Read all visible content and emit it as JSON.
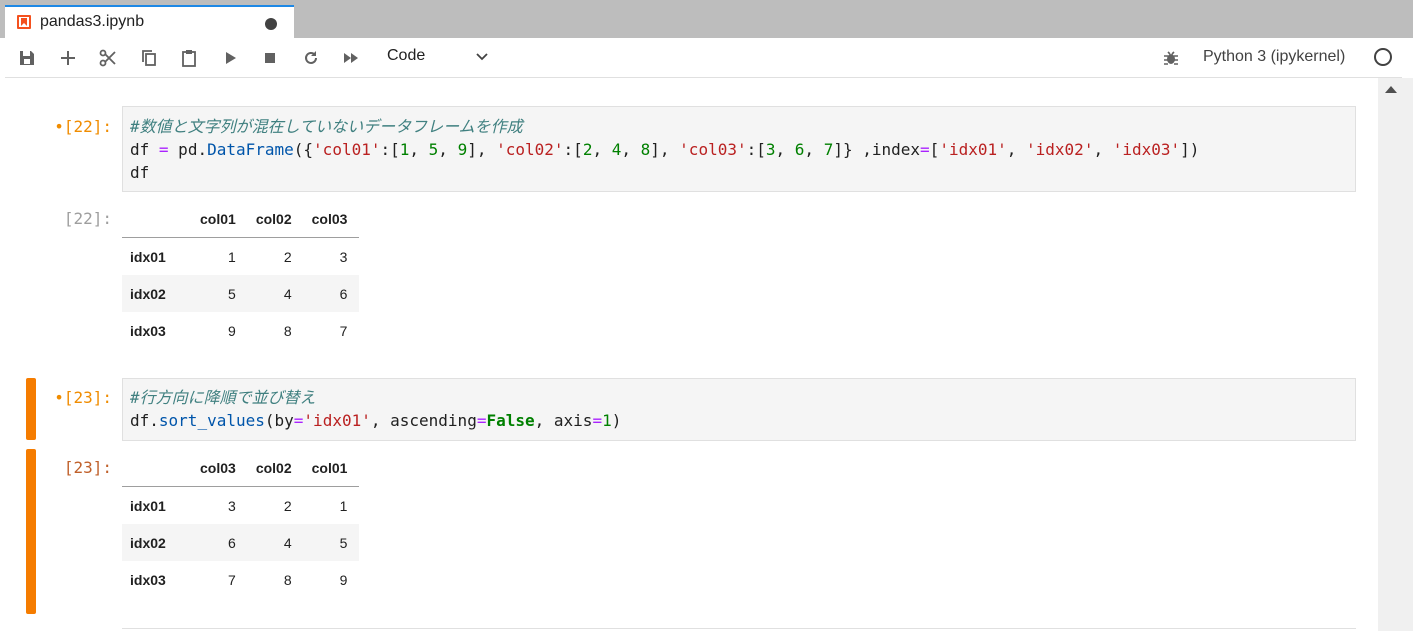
{
  "tab": {
    "title": "pandas3.ipynb",
    "icon": "notebook-icon"
  },
  "toolbar": {
    "buttons": [
      "save-icon",
      "add-icon",
      "cut-icon",
      "copy-icon",
      "paste-icon",
      "run-icon",
      "stop-icon",
      "restart-icon",
      "fast-forward-icon"
    ],
    "cell_type": "Code",
    "kernel": "Python 3 (ipykernel)"
  },
  "cells": [
    {
      "in_prompt": "•[22]:",
      "out_prompt": "[22]:",
      "code": {
        "comment": "#数値と文字列が混在していないデータフレームを作成",
        "line2": "df = pd.DataFrame({'col01':[1, 5, 9], 'col02':[2, 4, 8], 'col03':[3, 6, 7]} ,index=['idx01', 'idx02', 'idx03'])",
        "line3": "df"
      },
      "output": {
        "columns": [
          "col01",
          "col02",
          "col03"
        ],
        "rows": [
          {
            "index": "idx01",
            "values": [
              "1",
              "2",
              "3"
            ]
          },
          {
            "index": "idx02",
            "values": [
              "5",
              "4",
              "6"
            ]
          },
          {
            "index": "idx03",
            "values": [
              "9",
              "8",
              "7"
            ]
          }
        ]
      }
    },
    {
      "in_prompt": "•[23]:",
      "out_prompt": "[23]:",
      "code": {
        "comment": "#行方向に降順で並び替え",
        "line2": "df.sort_values(by='idx01', ascending=False, axis=1)"
      },
      "output": {
        "columns": [
          "col03",
          "col02",
          "col01"
        ],
        "rows": [
          {
            "index": "idx01",
            "values": [
              "3",
              "2",
              "1"
            ]
          },
          {
            "index": "idx02",
            "values": [
              "6",
              "4",
              "5"
            ]
          },
          {
            "index": "idx03",
            "values": [
              "7",
              "8",
              "9"
            ]
          }
        ]
      }
    }
  ],
  "colors": {
    "accent": "#f57c00",
    "tab_border": "#1e88e5"
  }
}
